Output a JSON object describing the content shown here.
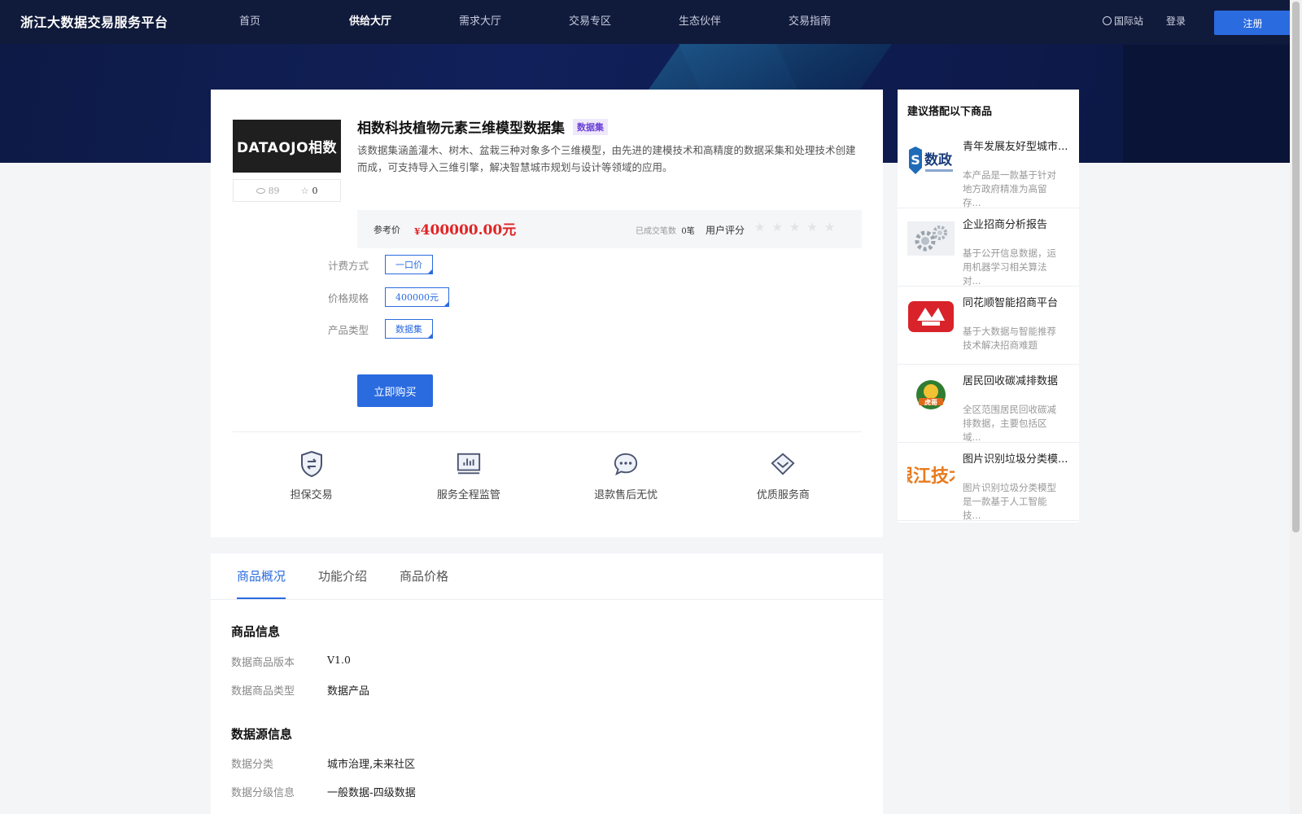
{
  "nav": {
    "brand": "浙江大数据交易服务平台",
    "items": [
      {
        "label": "首页",
        "active": false
      },
      {
        "label": "供给大厅",
        "active": true
      },
      {
        "label": "需求大厅",
        "active": false
      },
      {
        "label": "交易专区",
        "active": false
      },
      {
        "label": "生态伙伴",
        "active": false
      },
      {
        "label": "交易指南",
        "active": false
      }
    ],
    "intl": "国际站",
    "login": "登录",
    "register": "注册"
  },
  "product": {
    "logo_text": "DATAOJO相数",
    "views": "89",
    "favorites": "0",
    "title": "相数科技植物元素三维模型数据集",
    "tag": "数据集",
    "description": "该数据集涵盖灌木、树木、盆栽三种对象多个三维模型，由先进的建模技术和高精度的数据采集和处理技术创建而成，可支持导入三维引擎，解决智慧城市规划与设计等领域的应用。",
    "price_label": "参考价",
    "currency": "¥",
    "price": "400000.00元",
    "deals_label": "已成交笔数",
    "deals_count": "0笔",
    "rating_label": "用户评分",
    "rating": 0,
    "rating_max": 5,
    "options": [
      {
        "label": "计费方式",
        "value": "一口价"
      },
      {
        "label": "价格规格",
        "value": "400000元"
      },
      {
        "label": "产品类型",
        "value": "数据集"
      }
    ],
    "buy_label": "立即购买",
    "features": [
      {
        "icon": "shield-exchange-icon",
        "label": "担保交易"
      },
      {
        "icon": "monitor-chart-icon",
        "label": "服务全程监管"
      },
      {
        "icon": "chat-bubble-icon",
        "label": "退款售后无忧"
      },
      {
        "icon": "diamond-icon",
        "label": "优质服务商"
      }
    ]
  },
  "sidebar": {
    "title": "建议搭配以下商品",
    "items": [
      {
        "name": "青年发展友好型城市...",
        "desc": "本产品是一款基于针对地方政府精准为高留存...",
        "thumb": "shuzheng-logo"
      },
      {
        "name": "企业招商分析报告",
        "desc": "基于公开信息数据，运用机器学习相关算法对...",
        "thumb": "gears-icon"
      },
      {
        "name": "同花顺智能招商平台",
        "desc": "基于大数据与智能推荐技术解决招商难题",
        "thumb": "tonghuashun-logo"
      },
      {
        "name": "居民回收碳减排数据",
        "desc": "全区范围居民回收碳减排数据，主要包括区域...",
        "thumb": "hupo-logo"
      },
      {
        "name": "图片识别垃圾分类模...",
        "desc": "图片识别垃圾分类模型是一款基于人工智能技...",
        "thumb": "yinjiang-logo"
      }
    ]
  },
  "details": {
    "tabs": [
      {
        "label": "商品概况",
        "active": true
      },
      {
        "label": "功能介绍",
        "active": false
      },
      {
        "label": "商品价格",
        "active": false
      }
    ],
    "section1_title": "商品信息",
    "section1_rows": [
      {
        "key": "数据商品版本",
        "value": "V1.0"
      },
      {
        "key": "数据商品类型",
        "value": "数据产品"
      }
    ],
    "section2_title": "数据源信息",
    "section2_rows": [
      {
        "key": "数据分类",
        "value": "城市治理,未来社区"
      },
      {
        "key": "数据分级信息",
        "value": "一般数据-四级数据"
      }
    ]
  },
  "colors": {
    "accent": "#2a6be0",
    "price": "#e02424",
    "nav_bg": "#101a3a"
  }
}
